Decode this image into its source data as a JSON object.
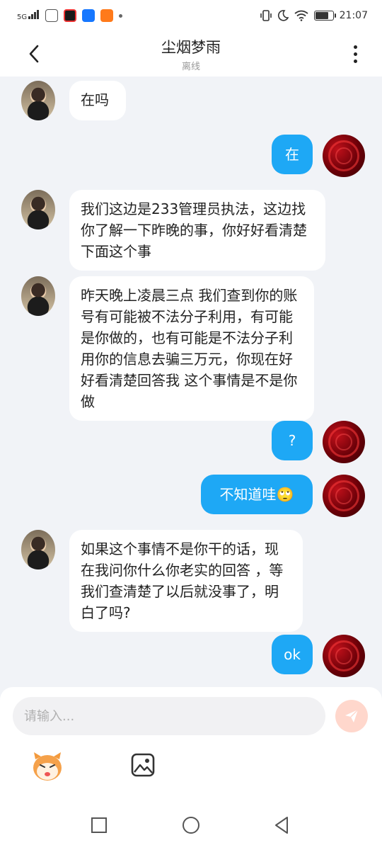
{
  "status_bar": {
    "network": "5G",
    "time": "21:07"
  },
  "header": {
    "contact_name": "尘烟梦雨",
    "contact_status": "离线"
  },
  "messages": [
    {
      "side": "in",
      "text": "在吗"
    },
    {
      "side": "out",
      "text": "在"
    },
    {
      "side": "in",
      "text": "我们这边是233管理员执法，这边找你了解一下昨晚的事，你好好看清楚下面这个事"
    },
    {
      "side": "in",
      "text": "昨天晚上凌晨三点 我们查到你的账号有可能被不法分子利用，有可能是你做的，也有可能是不法分子利用你的信息去骗三万元，你现在好好看清楚回答我 这个事情是不是你做"
    },
    {
      "side": "out",
      "text": "?"
    },
    {
      "side": "out",
      "text": "不知道哇🙄"
    },
    {
      "side": "in",
      "text": "如果这个事情不是你干的话，现在我问你什么你老实的回答 ，等我们查清楚了以后就没事了，明白了吗?"
    },
    {
      "side": "out",
      "text": "ok"
    }
  ],
  "composer": {
    "placeholder": "请输入..."
  },
  "colors": {
    "outgoing_bubble": "#1ea8f5",
    "incoming_bubble": "#ffffff",
    "background": "#f1f3f7",
    "send_button": "#ffd7cc"
  },
  "icons": {
    "back": "back-arrow-icon",
    "more": "more-vertical-icon",
    "send": "send-paper-plane-icon",
    "emoji": "emoji-icon",
    "image": "image-icon",
    "nav_recent": "square-icon",
    "nav_home": "circle-icon",
    "nav_back": "triangle-back-icon"
  }
}
